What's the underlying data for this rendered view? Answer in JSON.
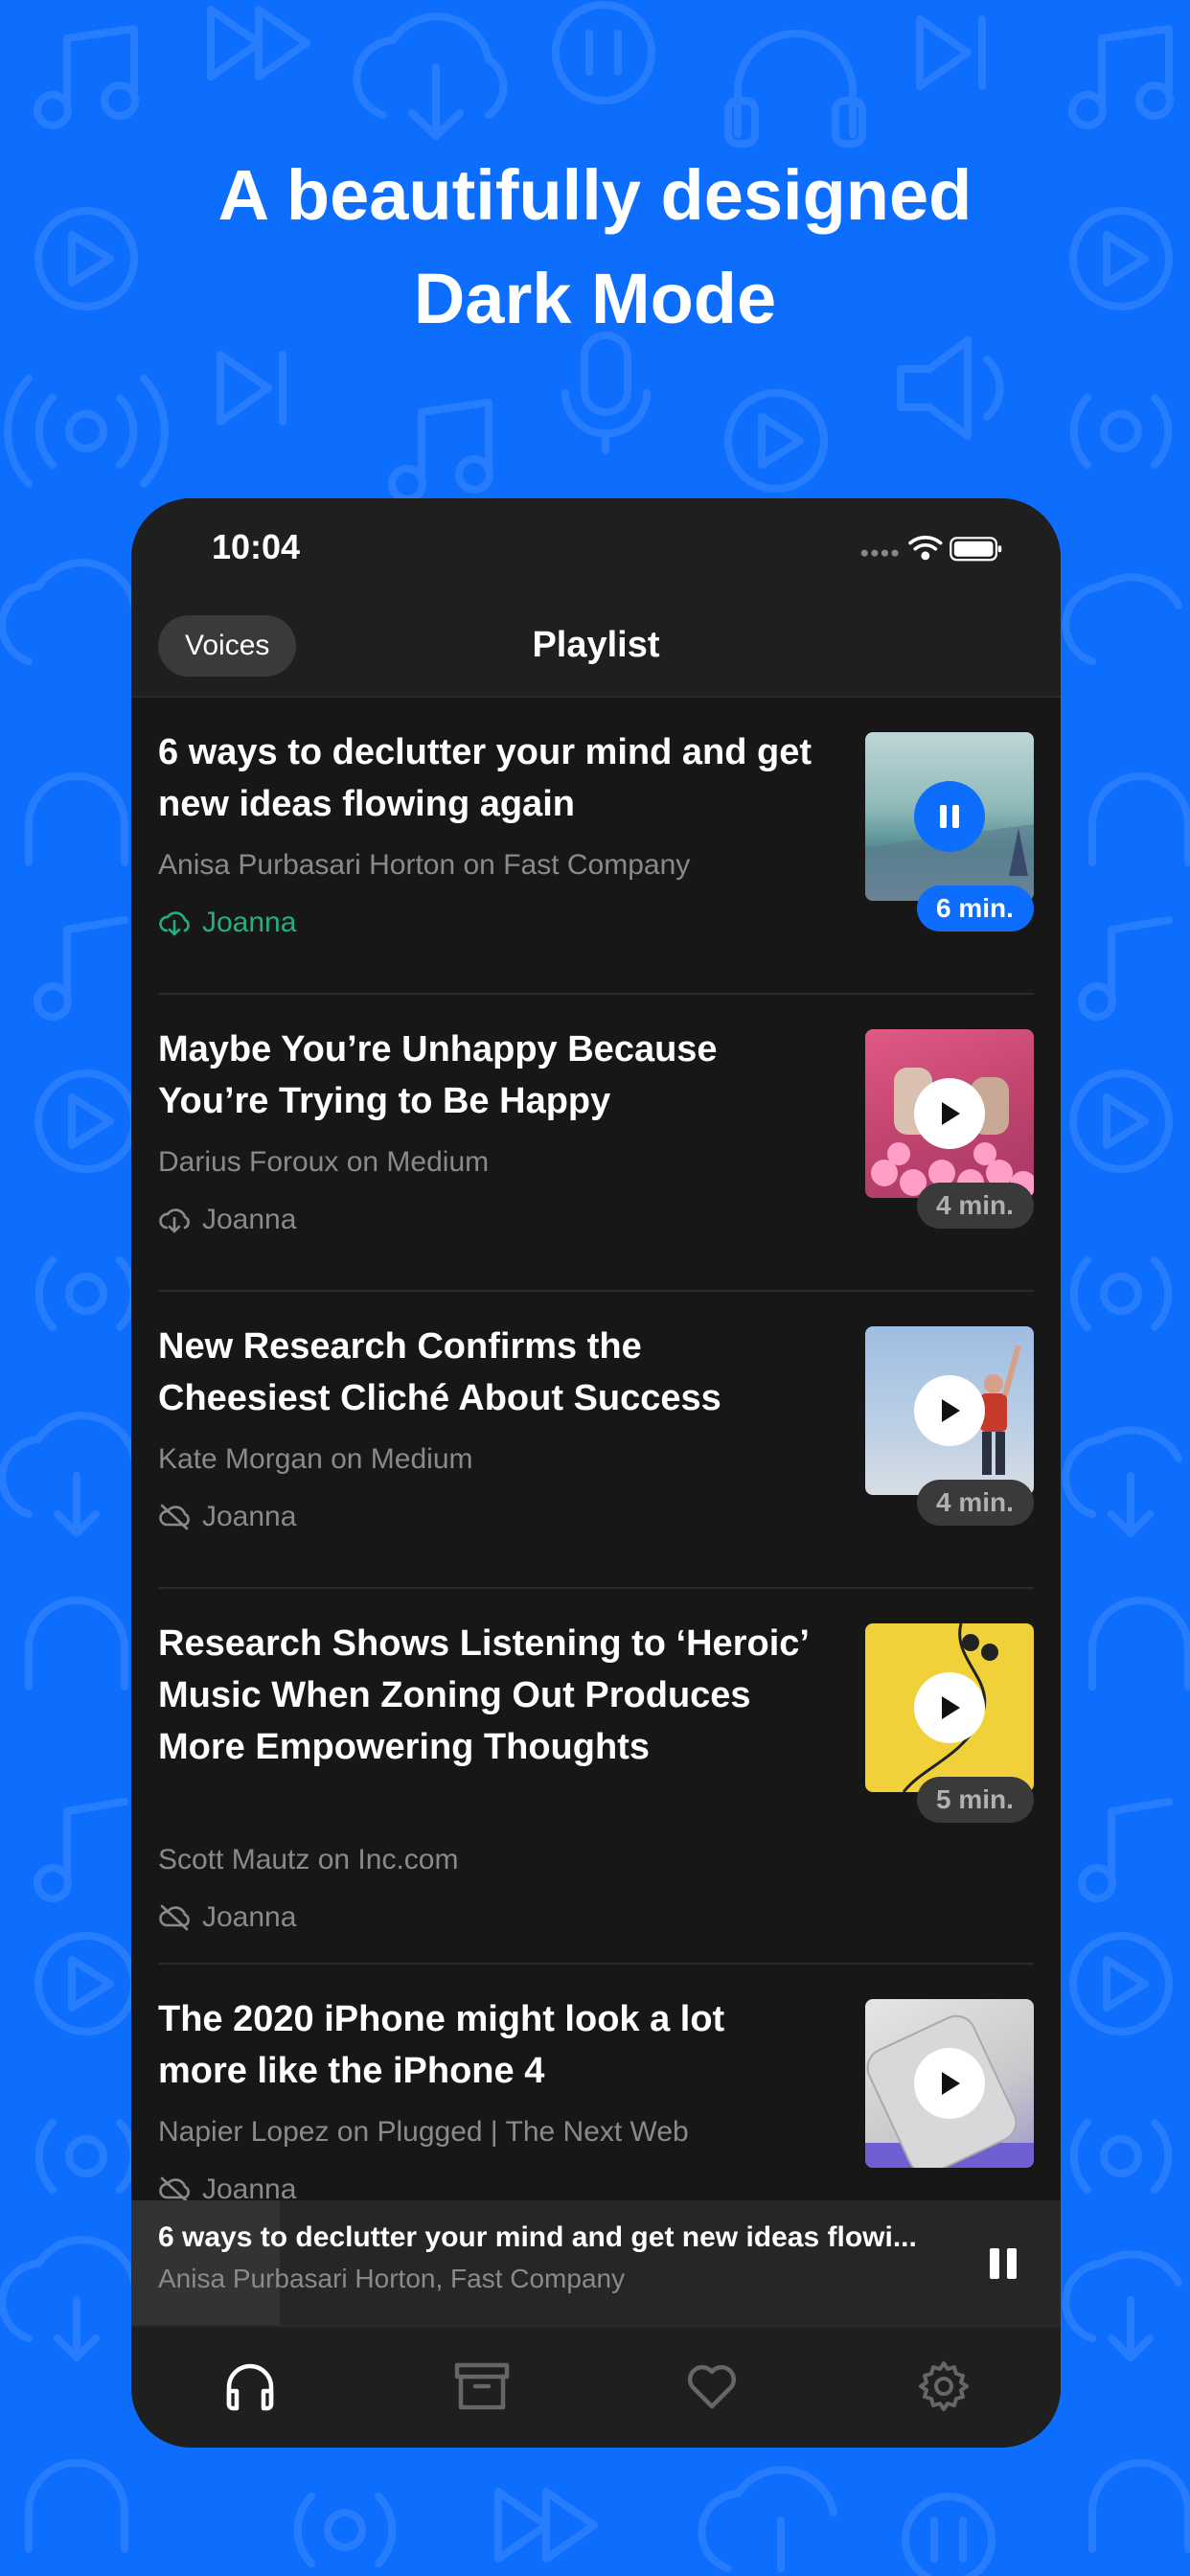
{
  "headline": {
    "line1": "A beautifully designed",
    "line2": "Dark Mode"
  },
  "status_bar": {
    "time": "10:04"
  },
  "nav": {
    "voices_label": "Voices",
    "title": "Playlist"
  },
  "articles": [
    {
      "title": "6 ways to declutter your mind and get new ideas flowing again",
      "source": "Anisa Purbasari Horton on Fast Company",
      "voice": "Joanna",
      "duration": "6 min.",
      "state": "playing",
      "voice_icon": "cloud-download-icon"
    },
    {
      "title": "Maybe You’re Unhappy Because You’re Trying to Be Happy",
      "source": "Darius Foroux on Medium",
      "voice": "Joanna",
      "duration": "4 min.",
      "state": "paused",
      "voice_icon": "cloud-download-icon"
    },
    {
      "title": "New Research Confirms the Cheesiest Cliché About Success",
      "source": "Kate Morgan on Medium",
      "voice": "Joanna",
      "duration": "4 min.",
      "state": "paused",
      "voice_icon": "cloud-off-icon"
    },
    {
      "title": "Research Shows Listening to ‘Heroic’ Music When Zoning Out Produces More Empowering Thoughts",
      "source": "Scott Mautz on Inc.com",
      "voice": "Joanna",
      "duration": "5 min.",
      "state": "paused",
      "voice_icon": "cloud-off-icon"
    },
    {
      "title": "The 2020 iPhone might look a lot more like the iPhone 4",
      "source": "Napier Lopez on Plugged | The Next Web",
      "voice": "Joanna",
      "duration": "",
      "state": "paused",
      "voice_icon": "cloud-off-icon"
    }
  ],
  "mini_player": {
    "title": "6 ways to declutter your mind and get new ideas flowi...",
    "subtitle": "Anisa Purbasari Horton, Fast Company",
    "progress": 0.16
  },
  "tabs": [
    {
      "name": "headphones-icon",
      "active": true
    },
    {
      "name": "archive-icon",
      "active": false
    },
    {
      "name": "heart-icon",
      "active": false
    },
    {
      "name": "gear-icon",
      "active": false
    }
  ],
  "colors": {
    "accent": "#0d6efd",
    "voice_active": "#22b07d",
    "background": "#171717"
  }
}
